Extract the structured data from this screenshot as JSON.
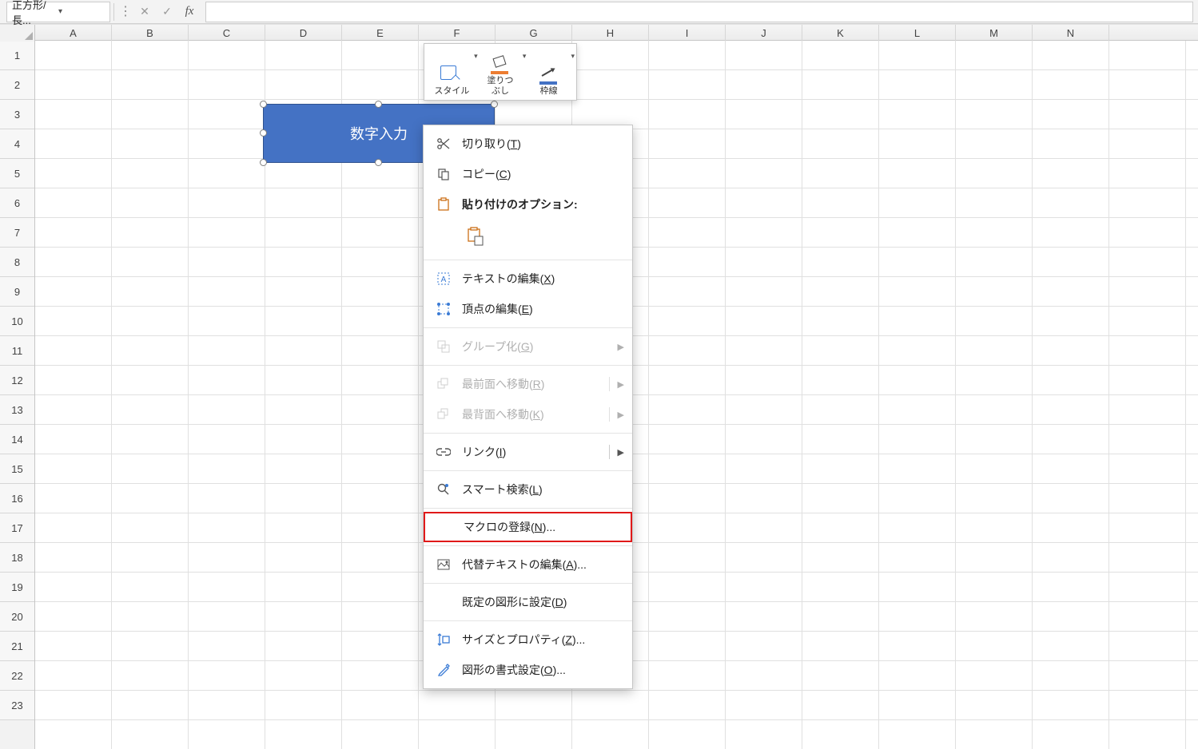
{
  "formula_bar": {
    "name_box": "正方形/長...",
    "cancel_glyph": "✕",
    "confirm_glyph": "✓",
    "fx_label": "fx"
  },
  "columns": [
    "A",
    "B",
    "C",
    "D",
    "E",
    "F",
    "G",
    "H",
    "I",
    "J",
    "K",
    "L",
    "M",
    "N"
  ],
  "rows": [
    "1",
    "2",
    "3",
    "4",
    "5",
    "6",
    "7",
    "8",
    "9",
    "10",
    "11",
    "12",
    "13",
    "14",
    "15",
    "16",
    "17",
    "18",
    "19",
    "20",
    "21",
    "22",
    "23"
  ],
  "shape": {
    "text": "数字入力"
  },
  "mini_toolbar": {
    "style": "スタイル",
    "fill": "塗りつ\nぶし",
    "border": "枠線"
  },
  "context_menu": {
    "cut": {
      "label": "切り取り(",
      "mn": "T",
      "suffix": ")"
    },
    "copy": {
      "label": "コピー(",
      "mn": "C",
      "suffix": ")"
    },
    "paste_hdr": "貼り付けのオプション:",
    "edit_text": {
      "label": "テキストの編集(",
      "mn": "X",
      "suffix": ")"
    },
    "edit_points": {
      "label": "頂点の編集(",
      "mn": "E",
      "suffix": ")"
    },
    "group": {
      "label": "グループ化(",
      "mn": "G",
      "suffix": ")"
    },
    "bring_front": {
      "label": "最前面へ移動(",
      "mn": "R",
      "suffix": ")"
    },
    "send_back": {
      "label": "最背面へ移動(",
      "mn": "K",
      "suffix": ")"
    },
    "link": {
      "label": "リンク(",
      "mn": "I",
      "suffix": ")"
    },
    "smart_find": {
      "label": "スマート検索(",
      "mn": "L",
      "suffix": ")"
    },
    "assign_macro": {
      "label": "マクロの登録(",
      "mn": "N",
      "suffix": ")..."
    },
    "alt_text": {
      "label": "代替テキストの編集(",
      "mn": "A",
      "suffix": ")..."
    },
    "set_default": {
      "label": "既定の図形に設定(",
      "mn": "D",
      "suffix": ")"
    },
    "size_props": {
      "label": "サイズとプロパティ(",
      "mn": "Z",
      "suffix": ")..."
    },
    "format_shape": {
      "label": "図形の書式設定(",
      "mn": "O",
      "suffix": ")..."
    }
  }
}
